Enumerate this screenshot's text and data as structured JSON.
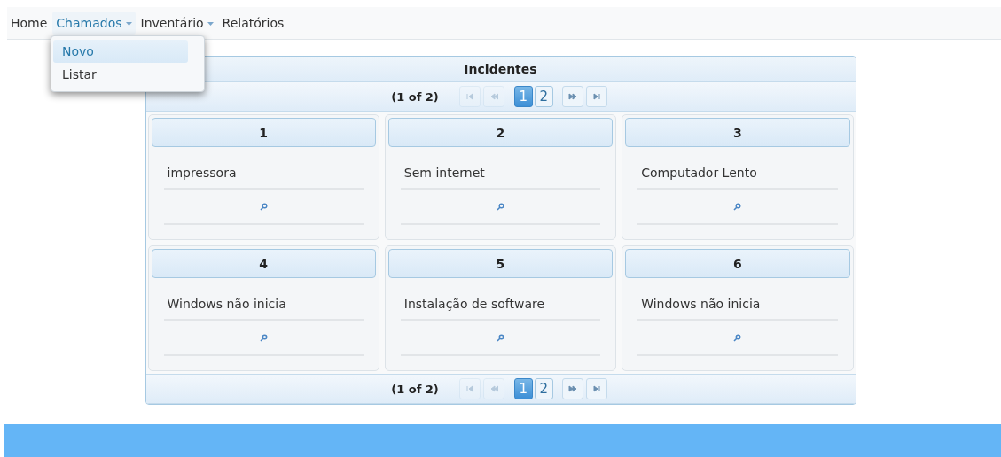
{
  "menubar": {
    "items": [
      {
        "label": "Home",
        "has_menu": false,
        "selected": false
      },
      {
        "label": "Chamados",
        "has_menu": true,
        "selected": true
      },
      {
        "label": "Inventário",
        "has_menu": true,
        "selected": false
      },
      {
        "label": "Relatórios",
        "has_menu": false,
        "selected": false
      }
    ]
  },
  "dropdown": {
    "items": [
      {
        "label": "Novo",
        "selected": true
      },
      {
        "label": "Listar",
        "selected": false
      }
    ]
  },
  "panel": {
    "title": "Incidentes",
    "paginators": [
      {
        "report": "(1 of 2)",
        "nav": [
          {
            "kind": "first",
            "disabled": true
          },
          {
            "kind": "prev",
            "disabled": true
          },
          {
            "kind": "next",
            "disabled": false
          },
          {
            "kind": "last",
            "disabled": false
          }
        ],
        "pages": [
          {
            "label": "1",
            "selected": true
          },
          {
            "label": "2",
            "selected": false
          }
        ]
      },
      {
        "report": "(1 of 2)",
        "nav": [
          {
            "kind": "first",
            "disabled": true
          },
          {
            "kind": "prev",
            "disabled": true
          },
          {
            "kind": "next",
            "disabled": false
          },
          {
            "kind": "last",
            "disabled": false
          }
        ],
        "pages": [
          {
            "label": "1",
            "selected": true
          },
          {
            "label": "2",
            "selected": false
          }
        ]
      }
    ],
    "cards": [
      {
        "number": "1",
        "text": "impressora"
      },
      {
        "number": "2",
        "text": "Sem internet"
      },
      {
        "number": "3",
        "text": "Computador Lento"
      },
      {
        "number": "4",
        "text": "Windows não inicia"
      },
      {
        "number": "5",
        "text": "Instalação de software"
      },
      {
        "number": "6",
        "text": "Windows não inicia"
      }
    ]
  }
}
